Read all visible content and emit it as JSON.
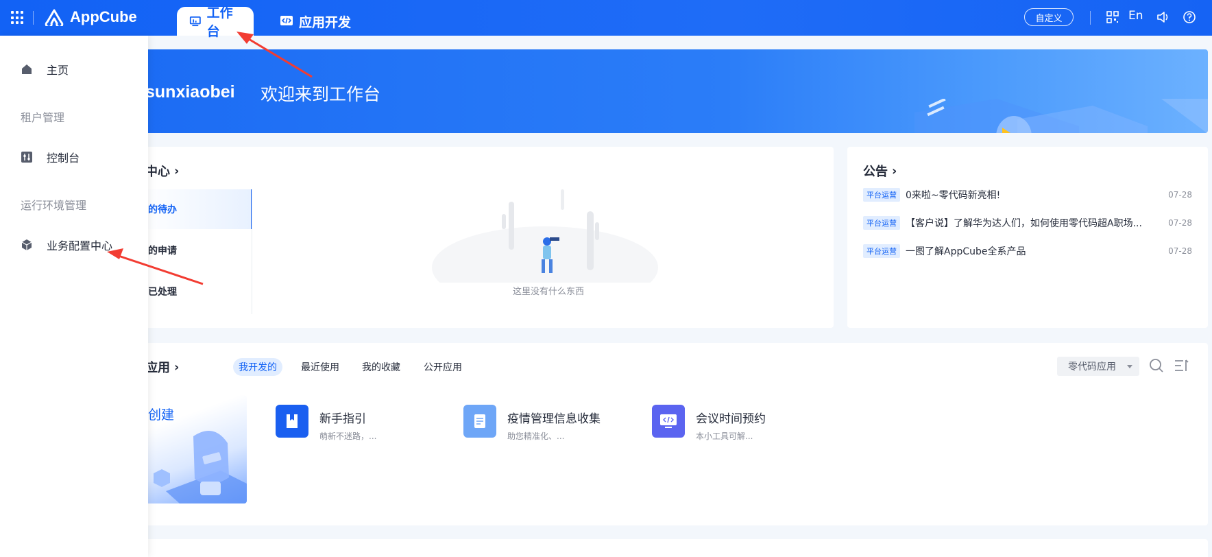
{
  "topbar": {
    "logo_text": "AppCube",
    "tabs": [
      {
        "label": "工作台",
        "icon": "dashboard-icon",
        "active": true
      },
      {
        "label": "应用开发",
        "icon": "code-icon",
        "active": false
      }
    ],
    "custom_label": "自定义",
    "language_label": "En",
    "icons": [
      "app-grid-icon",
      "qr-code-icon",
      "sound-icon",
      "help-icon"
    ]
  },
  "banner": {
    "username": "sunxiaobei",
    "welcome": "欢迎来到工作台"
  },
  "todo": {
    "title": "中心",
    "items": [
      "的待办",
      "的申请",
      "已处理"
    ],
    "empty_text": "这里没有什么东西"
  },
  "notice": {
    "title": "公告",
    "items": [
      {
        "tag": "平台运营",
        "title": "0来啦~零代码新亮相!",
        "date": "07-28"
      },
      {
        "tag": "平台运营",
        "title": "【客户说】了解华为达人们，如何使用零代码超A职场...",
        "date": "07-28"
      },
      {
        "tag": "平台运营",
        "title": "一图了解AppCube全系产品",
        "date": "07-28"
      }
    ]
  },
  "apps": {
    "title": "应用",
    "filters": [
      "我开发的",
      "最近使用",
      "我的收藏",
      "公开应用"
    ],
    "select_value": "零代码应用",
    "create_label": "创建",
    "items": [
      {
        "name": "新手指引",
        "desc": "萌新不迷路，...",
        "color": "#1a5ff0"
      },
      {
        "name": "疫情管理信息收集",
        "desc": "助您精准化、...",
        "color": "#6ea6f7"
      },
      {
        "name": "会议时间预约",
        "desc": "本小工具可解...",
        "color": "#5b64f0"
      }
    ]
  },
  "sidebar": {
    "home_label": "主页",
    "group_tenant": "租户管理",
    "console_label": "控制台",
    "group_runtime": "运行环境管理",
    "config_label": "业务配置中心"
  },
  "colors": {
    "primary": "#1262f5",
    "annotation_arrow": "#f23c32"
  }
}
